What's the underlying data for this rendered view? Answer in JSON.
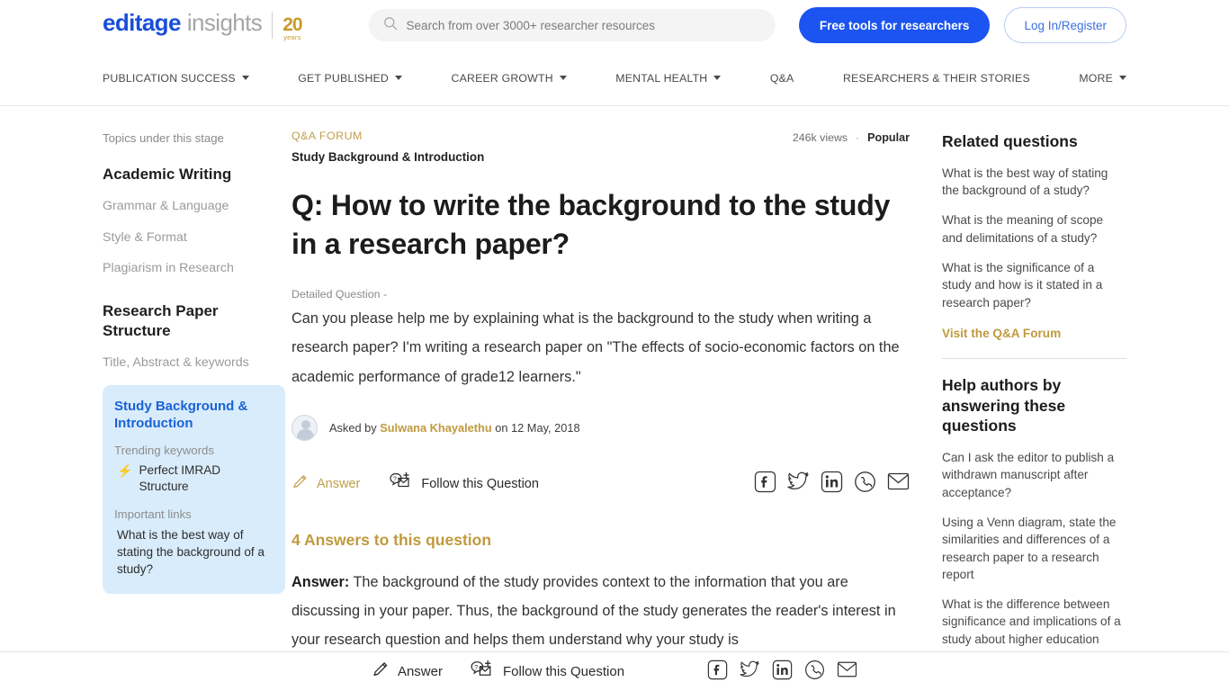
{
  "header": {
    "logo": {
      "brand": "editage",
      "product": "insights",
      "anniversary_number": "20",
      "anniversary_unit": "years"
    },
    "search": {
      "placeholder": "Search from over 3000+ researcher resources",
      "value": "",
      "icon": "search-icon"
    },
    "free_tools_label": "Free tools for researchers",
    "login_label": "Log In/Register",
    "accent_blue": "#1b54f0",
    "brand_blue": "#1a4fd6",
    "brand_gold": "#c89a28"
  },
  "nav": {
    "items": [
      {
        "label": "PUBLICATION SUCCESS",
        "has_caret": true
      },
      {
        "label": "GET PUBLISHED",
        "has_caret": true
      },
      {
        "label": "CAREER GROWTH",
        "has_caret": true
      },
      {
        "label": "MENTAL HEALTH",
        "has_caret": true
      },
      {
        "label": "Q&A",
        "has_caret": false
      },
      {
        "label": "RESEARCHERS & THEIR STORIES",
        "has_caret": false
      },
      {
        "label": "MORE",
        "has_caret": true
      }
    ]
  },
  "left_rail": {
    "caption": "Topics under this stage",
    "section1_title": "Academic Writing",
    "section1_items": [
      "Grammar & Language",
      "Style & Format",
      "Plagiarism in Research"
    ],
    "section2_title": "Research Paper Structure",
    "section2_items": [
      "Title, Abstract & keywords"
    ],
    "active_card": {
      "title": "Study Background & Introduction",
      "trending_label": "Trending keywords",
      "trending_keyword": "Perfect IMRAD Structure",
      "links_label": "Important links",
      "link_1": "What is the best way of stating the background of a study?",
      "bg_color": "#d9ecfb",
      "title_color": "#1a62d6",
      "bolt_color": "#2fc24b"
    }
  },
  "main": {
    "kicker": "Q&A FORUM",
    "subcategory": "Study Background & Introduction",
    "views": "246k views",
    "separator": "·",
    "popular_badge": "Popular",
    "question_title": "Q: How to write the background to the study in a research paper?",
    "detail_label": "Detailed Question -",
    "detail_body": "Can you please help me by explaining what is the background to the study when writing a research paper? I'm writing a research paper on \"The effects of socio-economic factors on the academic performance of grade12 learners.\"",
    "byline_prefix": "Asked by",
    "byline_author": "Sulwana Khayalethu",
    "byline_suffix": "on 12 May, 2018",
    "answer_action": "Answer",
    "follow_action": "Follow this Question",
    "share_icons": [
      "facebook-icon",
      "twitter-icon",
      "linkedin-icon",
      "whatsapp-icon",
      "email-icon"
    ],
    "answers_heading": "4 Answers to this question",
    "answer_label": "Answer:",
    "answer_body": " The background of the study provides context to the information that you are discussing in your paper. Thus, the background of the study generates the reader's interest in your research question and helps them understand why your study is",
    "gold": "#c09a3e"
  },
  "right_rail": {
    "related_title": "Related questions",
    "related_items": [
      "What is the best way of stating the background of a study?",
      "What is the meaning of scope and delimitations of a study?",
      "What is the significance of a study and how is it stated in a research paper?"
    ],
    "forum_link": "Visit the Q&A Forum",
    "help_title": "Help authors by answering these questions",
    "help_items": [
      "Can I ask the editor to publish a withdrawn manuscript after acceptance?",
      "Using a Venn diagram, state the similarities and differences of a research paper to a research report",
      "What is the difference between significance and implications of a study about higher education sustainability"
    ]
  },
  "bottom_bar": {
    "answer_action": "Answer",
    "follow_action": "Follow this Question",
    "share_icons": [
      "facebook-icon",
      "twitter-icon",
      "linkedin-icon",
      "whatsapp-icon",
      "email-icon"
    ]
  }
}
